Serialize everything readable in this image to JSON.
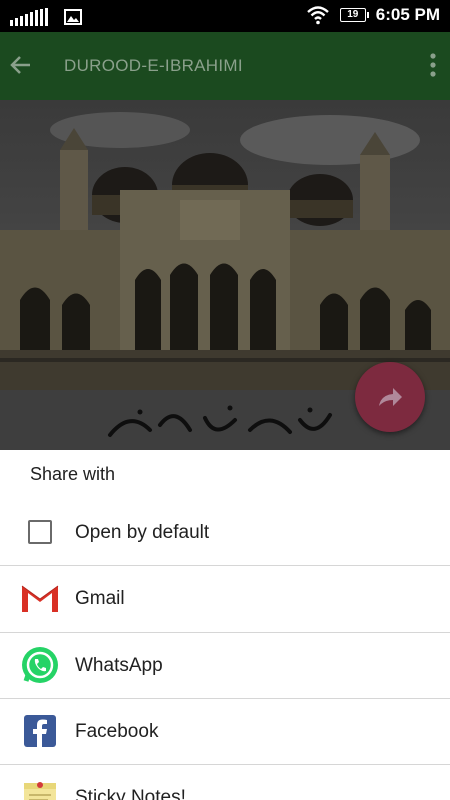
{
  "status_bar": {
    "time": "6:05 PM",
    "battery": "19",
    "icons": [
      "signal-icon",
      "image-notification-icon",
      "wifi-icon",
      "battery-icon"
    ]
  },
  "app_bar": {
    "title": "DUROOD-E-IBRAHIMI",
    "back_icon": "back-arrow-icon",
    "menu_icon": "overflow-menu-icon",
    "color": "#1b4a1f"
  },
  "fab": {
    "icon": "share-icon",
    "color": "#c2185b"
  },
  "share_sheet": {
    "title": "Share with",
    "open_by_default": {
      "label": "Open by default",
      "checked": false
    },
    "apps": [
      {
        "label": "Gmail",
        "icon": "gmail-icon"
      },
      {
        "label": "WhatsApp",
        "icon": "whatsapp-icon"
      },
      {
        "label": "Facebook",
        "icon": "facebook-icon"
      },
      {
        "label": "Sticky Notes!",
        "icon": "sticky-notes-icon"
      }
    ]
  }
}
